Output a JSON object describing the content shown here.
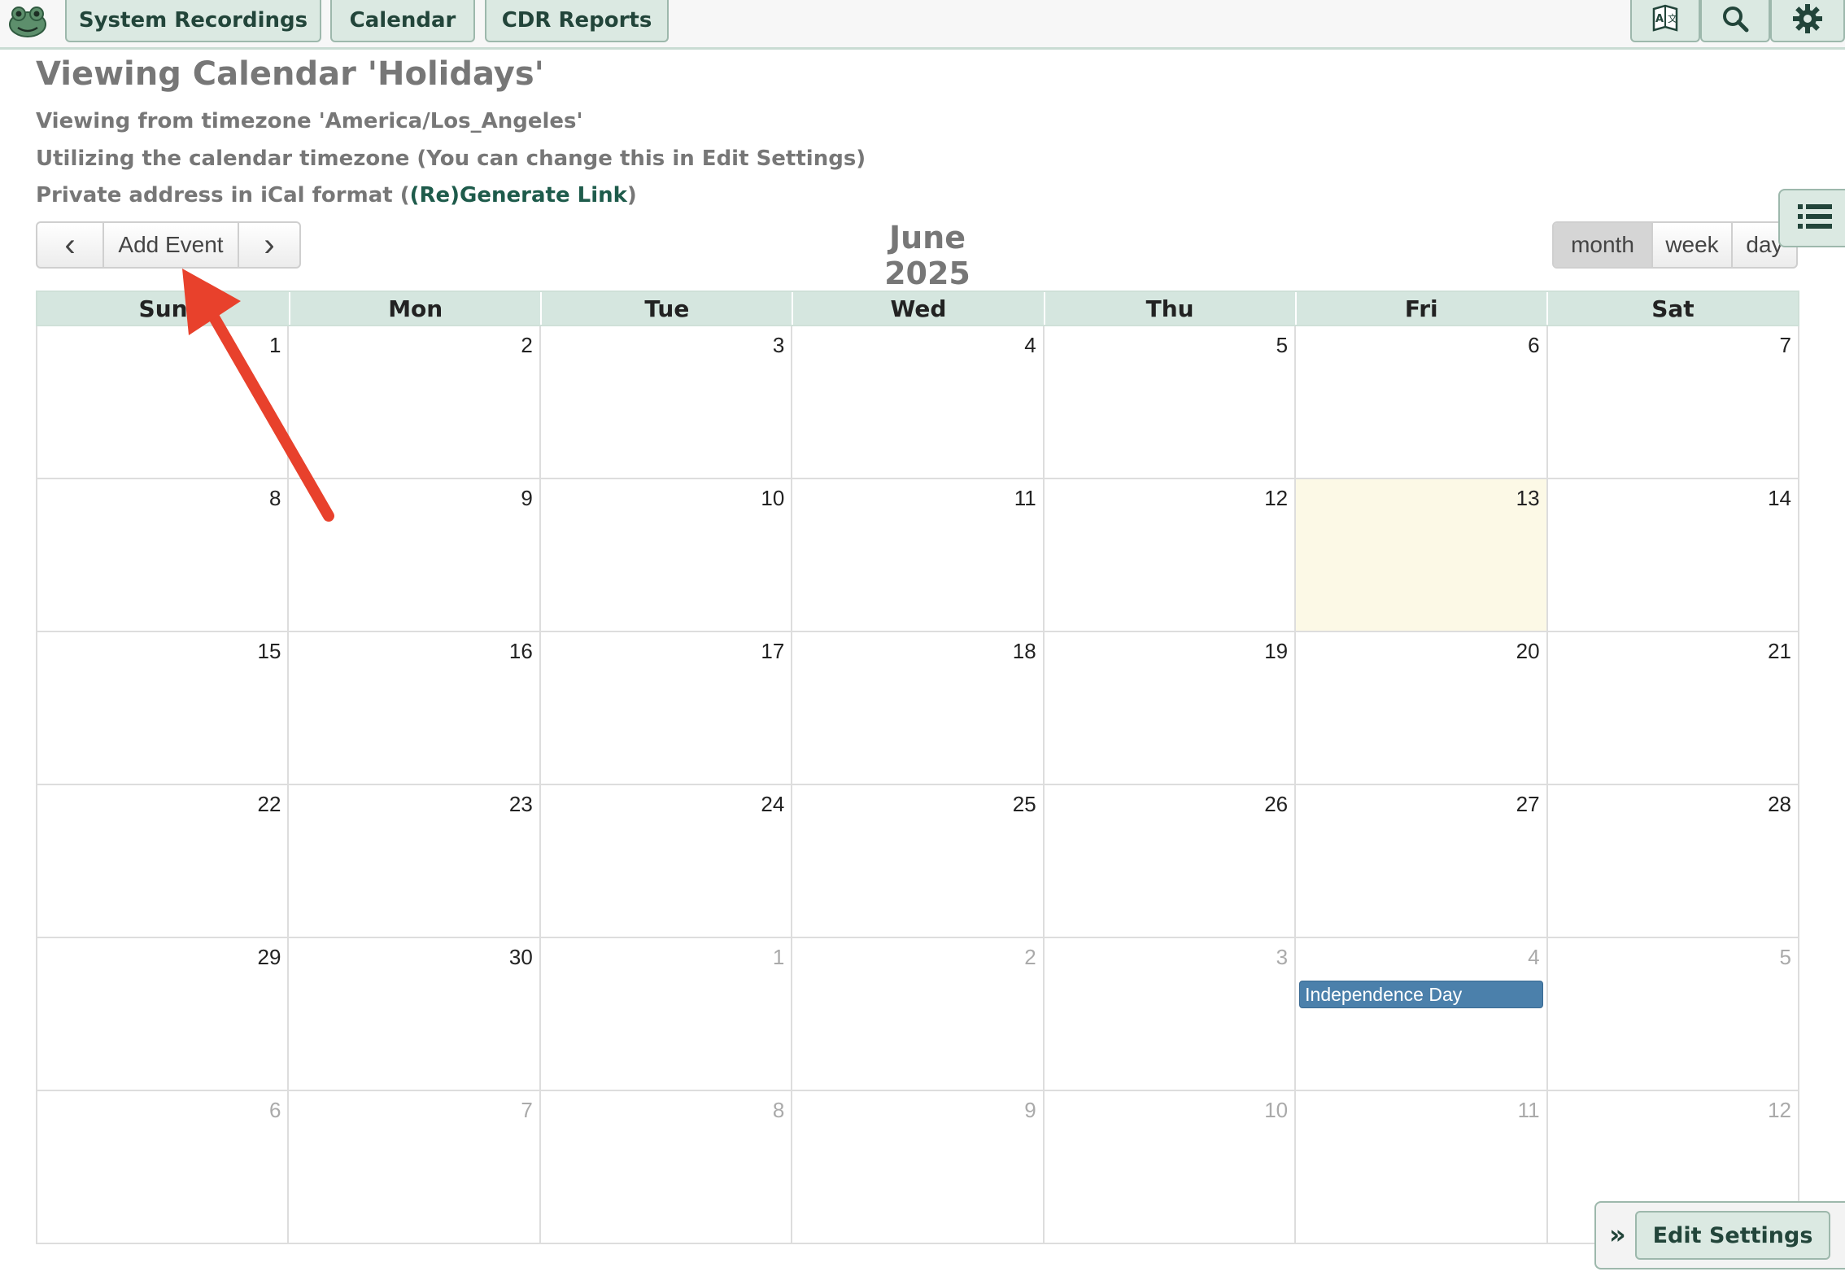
{
  "nav": {
    "buttons": [
      "System Recordings",
      "Calendar",
      "CDR Reports"
    ]
  },
  "page": {
    "title": "Viewing Calendar 'Holidays'",
    "timezone_line": "Viewing from timezone 'America/Los_Angeles'",
    "utilizing_line": "Utilizing the calendar timezone (You can change this in Edit Settings)",
    "ical_prefix": "Private address in iCal format (",
    "ical_link": "(Re)Generate Link",
    "ical_suffix": ")"
  },
  "toolbar": {
    "prev": "‹",
    "add_event": "Add Event",
    "next": "›",
    "month_title": "June 2025",
    "views": [
      "month",
      "week",
      "day"
    ],
    "active_view": "month"
  },
  "calendar": {
    "days_of_week": [
      "Sun",
      "Mon",
      "Tue",
      "Wed",
      "Thu",
      "Fri",
      "Sat"
    ],
    "weeks": [
      [
        {
          "d": "1"
        },
        {
          "d": "2"
        },
        {
          "d": "3"
        },
        {
          "d": "4"
        },
        {
          "d": "5"
        },
        {
          "d": "6"
        },
        {
          "d": "7"
        }
      ],
      [
        {
          "d": "8"
        },
        {
          "d": "9"
        },
        {
          "d": "10"
        },
        {
          "d": "11"
        },
        {
          "d": "12"
        },
        {
          "d": "13",
          "today": true
        },
        {
          "d": "14"
        }
      ],
      [
        {
          "d": "15"
        },
        {
          "d": "16"
        },
        {
          "d": "17"
        },
        {
          "d": "18"
        },
        {
          "d": "19"
        },
        {
          "d": "20"
        },
        {
          "d": "21"
        }
      ],
      [
        {
          "d": "22"
        },
        {
          "d": "23"
        },
        {
          "d": "24"
        },
        {
          "d": "25"
        },
        {
          "d": "26"
        },
        {
          "d": "27"
        },
        {
          "d": "28"
        }
      ],
      [
        {
          "d": "29"
        },
        {
          "d": "30"
        },
        {
          "d": "1",
          "other": true
        },
        {
          "d": "2",
          "other": true
        },
        {
          "d": "3",
          "other": true
        },
        {
          "d": "4",
          "other": true,
          "event": "Independence Day"
        },
        {
          "d": "5",
          "other": true
        }
      ],
      [
        {
          "d": "6",
          "other": true
        },
        {
          "d": "7",
          "other": true
        },
        {
          "d": "8",
          "other": true
        },
        {
          "d": "9",
          "other": true
        },
        {
          "d": "10",
          "other": true
        },
        {
          "d": "11",
          "other": true
        },
        {
          "d": "12",
          "other": true
        }
      ]
    ]
  },
  "settings": {
    "expand": "»",
    "edit_label": "Edit Settings"
  },
  "colors": {
    "accent": "#dbe9e2",
    "accent_text": "#22453a",
    "event": "#4b80ab",
    "today": "#fcf9e6",
    "annotation_arrow": "#e8412c"
  },
  "icons": [
    "frog-logo-icon",
    "translate-icon",
    "search-icon",
    "gear-icon",
    "list-icon"
  ]
}
